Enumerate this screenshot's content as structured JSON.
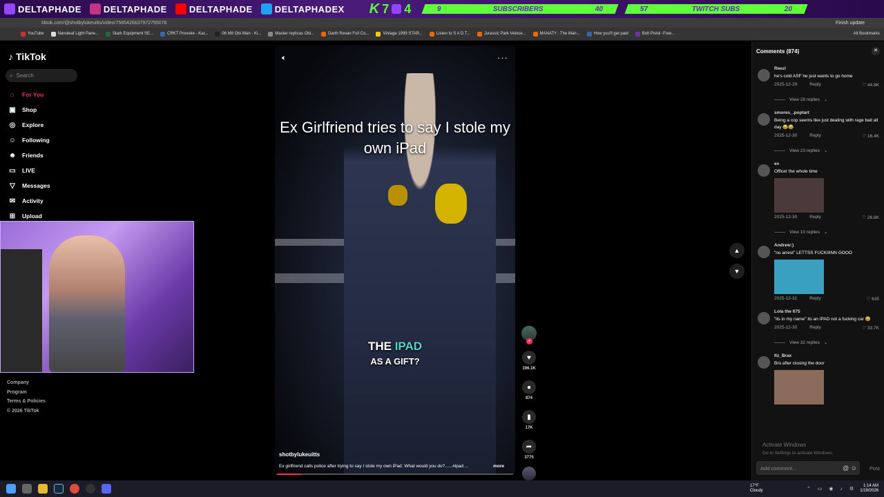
{
  "overlay": {
    "socials": [
      "DELTAPHADE",
      "DELTAPHADE",
      "DELTAPHADE",
      "DELTAPHADEX"
    ],
    "counter_a": "7",
    "counter_b": "4",
    "subs_current": "9",
    "subs_label": "SUBSCRIBERS",
    "subs_goal": "40",
    "twitch_current": "57",
    "twitch_label": "TWITCH SUBS",
    "twitch_goal": "20"
  },
  "browser": {
    "url": "tiktok.com/@shotbylukeuitts/video/7585426637972755078",
    "update_label": "Finish update",
    "bookmarks": [
      "YouTube",
      "Nanoleaf Light Pane...",
      "Stark Equipment SE...",
      "CRKT Provoke - Kar...",
      "06 M8 Obi Wan - Ki...",
      "Master replicas Obi...",
      "Darth Revan Full Co...",
      "Vintage 1999 STAR...",
      "Listen to S A D T...",
      "Jurassic Park Veloce...",
      "MANATY : The Man...",
      "How you'll get paid",
      "Bolt Pistol -Free..."
    ],
    "all_bookmarks": "All Bookmarks"
  },
  "sidebar": {
    "brand": "TikTok",
    "search_placeholder": "Search",
    "nav": [
      {
        "label": "For You",
        "icon": "home-icon"
      },
      {
        "label": "Shop",
        "icon": "shop-icon"
      },
      {
        "label": "Explore",
        "icon": "compass-icon"
      },
      {
        "label": "Following",
        "icon": "following-icon"
      },
      {
        "label": "Friends",
        "icon": "friends-icon"
      },
      {
        "label": "LIVE",
        "icon": "live-icon"
      },
      {
        "label": "Messages",
        "icon": "messages-icon"
      },
      {
        "label": "Activity",
        "icon": "activity-icon"
      },
      {
        "label": "Upload",
        "icon": "upload-icon"
      }
    ],
    "footer": [
      "Company",
      "Program",
      "Terms & Policies",
      "© 2026 TikTok"
    ]
  },
  "video": {
    "title": "Ex Girlfriend tries to say I stole my own iPad",
    "caption_pre": "THE ",
    "caption_highlight": "IPAD",
    "caption_line2": "AS A GIFT?",
    "author": "shotbylukeuitts",
    "description": "Ex girlfriend calls police after trying to say I stole my own iPad. What would you do?......#ipad ...",
    "more": "more",
    "progress_fraction": 0.11,
    "likes": "196.1K",
    "comments": "874",
    "saves": "17K",
    "shares": "3775"
  },
  "comments_panel": {
    "title": "Comments (874)",
    "add_placeholder": "Add comment...",
    "post_label": "Post",
    "items": [
      {
        "user": "Reezi",
        "text": "he's cold ASF he just wants to go home",
        "date": "2025-12-29",
        "reply": "Reply",
        "likes": "44.8K",
        "views": "View 28 replies",
        "image": false
      },
      {
        "user": "smores_.poptart",
        "text": "Being a cop seems like just dealing with rage bait all day 😂😂",
        "date": "2025-12-30",
        "reply": "Reply",
        "likes": "16.4K",
        "views": "View 23 replies",
        "image": false
      },
      {
        "user": "ex",
        "text": "Officer the whole time",
        "date": "2025-12-30",
        "reply": "Reply",
        "likes": "26.8K",
        "views": "View 10 replies",
        "image": true,
        "image_color": "#4a3a3a"
      },
      {
        "user": "Andrew:)",
        "text": "\"no arrest\" LETTSS FUCKIIINN GOOO",
        "date": "2025-12-31",
        "reply": "Reply",
        "likes": "635",
        "views": "",
        "image": true,
        "image_color": "#3aa0c0"
      },
      {
        "user": "Lola the 675",
        "text": "\"its in my name\" its an IPAD not a fucking car 😂",
        "date": "2025-12-30",
        "reply": "Reply",
        "likes": "33.7K",
        "views": "View 32 replies",
        "image": false
      },
      {
        "user": "Itz_Brax",
        "text": "Bro after closing the door",
        "date": "",
        "reply": "",
        "likes": "",
        "views": "",
        "image": true,
        "image_color": "#8a6a5a"
      }
    ]
  },
  "windows": {
    "activate_title": "Activate Windows",
    "activate_sub": "Go to Settings to activate Windows.",
    "temp": "17°F",
    "weather": "Cloudy",
    "time": "1:14 AM",
    "date": "1/19/2026"
  }
}
